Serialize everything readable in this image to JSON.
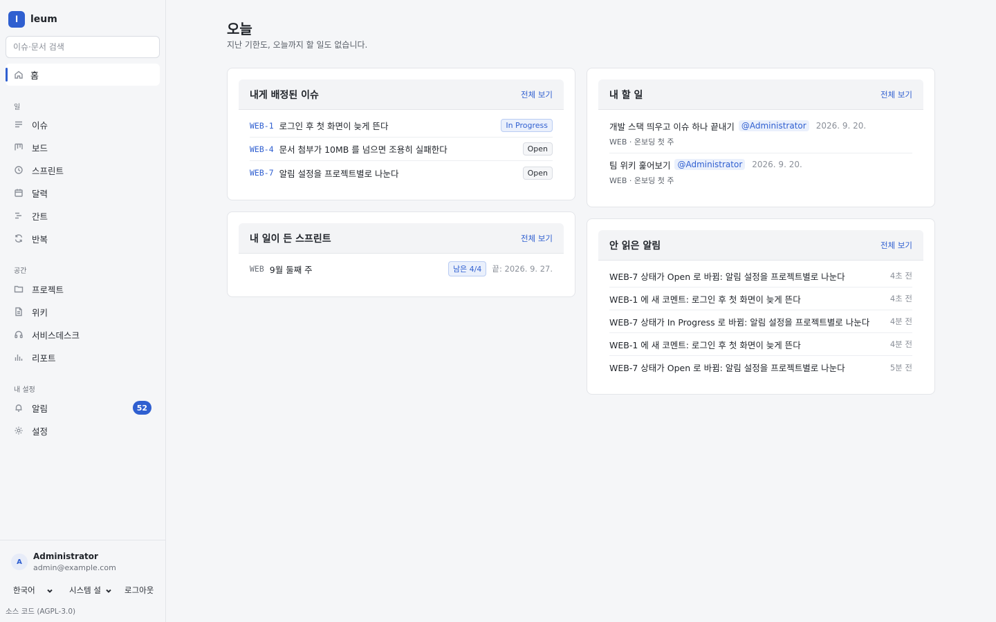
{
  "brand": {
    "logo_letter": "l",
    "name": "leum"
  },
  "search": {
    "placeholder": "이슈·문서 검색"
  },
  "nav": {
    "home": "홈",
    "section_work": "일",
    "work_items": [
      "이슈",
      "보드",
      "스프린트",
      "달력",
      "간트",
      "반복"
    ],
    "section_space": "공간",
    "space_items": [
      "프로젝트",
      "위키",
      "서비스데스크",
      "리포트"
    ],
    "section_settings": "내 설정",
    "settings_items": [
      "알림",
      "설정"
    ],
    "notification_count": "52"
  },
  "user": {
    "avatar": "A",
    "name": "Administrator",
    "email": "admin@example.com"
  },
  "footer": {
    "language": "한국어",
    "system": "시스템 설",
    "logout": "로그아웃",
    "source": "소스 코드 (AGPL-3.0)"
  },
  "page": {
    "title": "오늘",
    "subtitle": "지난 기한도, 오늘까지 할 일도 없습니다."
  },
  "assigned": {
    "title": "내게 배정된 이슈",
    "view_all": "전체 보기",
    "rows": [
      {
        "key": "WEB-1",
        "title": "로그인 후 첫 화면이 늦게 뜬다",
        "status": "In Progress"
      },
      {
        "key": "WEB-4",
        "title": "문서 첨부가 10MB 를 넘으면 조용히 실패한다",
        "status": "Open"
      },
      {
        "key": "WEB-7",
        "title": "알림 설정을 프로젝트별로 나눈다",
        "status": "Open"
      }
    ]
  },
  "sprints": {
    "title": "내 일이 든 스프린트",
    "view_all": "전체 보기",
    "row": {
      "project": "WEB",
      "name": "9월 둘째 주",
      "remaining": "남은 4/4",
      "end": "끝: 2026. 9. 27."
    }
  },
  "todos": {
    "title": "내 할 일",
    "view_all": "전체 보기",
    "items": [
      {
        "title": "개발 스택 띄우고 이슈 하나 끝내기",
        "mention": "@Administrator",
        "date": "2026. 9. 20.",
        "meta": "WEB · 온보딩 첫 주"
      },
      {
        "title": "팀 위키 훑어보기",
        "mention": "@Administrator",
        "date": "2026. 9. 20.",
        "meta": "WEB · 온보딩 첫 주"
      }
    ]
  },
  "notifications": {
    "title": "안 읽은 알림",
    "view_all": "전체 보기",
    "rows": [
      {
        "text": "WEB-7 상태가 Open 로 바뀜: 알림 설정을 프로젝트별로 나눈다",
        "time": "4초 전"
      },
      {
        "text": "WEB-1 에 새 코멘트: 로그인 후 첫 화면이 늦게 뜬다",
        "time": "4초 전"
      },
      {
        "text": "WEB-7 상태가 In Progress 로 바뀜: 알림 설정을 프로젝트별로 나눈다",
        "time": "4분 전"
      },
      {
        "text": "WEB-1 에 새 코멘트: 로그인 후 첫 화면이 늦게 뜬다",
        "time": "4분 전"
      },
      {
        "text": "WEB-7 상태가 Open 로 바뀜: 알림 설정을 프로젝트별로 나눈다",
        "time": "5분 전"
      }
    ]
  },
  "colors": {
    "accent": "#2f5fd0",
    "sidebar_bg": "#f5f6f8",
    "card_bg": "#ffffff"
  }
}
